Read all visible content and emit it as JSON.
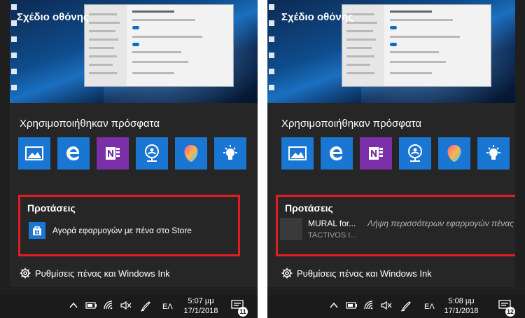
{
  "colors": {
    "panel_bg": "#1f1f1f",
    "tile_blue": "#1976d2",
    "tile_purple": "#7b2fa8",
    "highlight_red": "#e31b23",
    "taskbar_bg": "#1b1b1b"
  },
  "left": {
    "screen_sketch_label": "Σχέδιο οθόνης",
    "recent_title": "Χρησιμοποιήθηκαν πρόσφατα",
    "recent_apps": [
      "photos-icon",
      "edge-icon",
      "onenote-icon",
      "maps-icon",
      "paint3d-icon",
      "tips-icon"
    ],
    "suggestions_title": "Προτάσεις",
    "suggestion_text": "Αγορά εφαρμογών με πένα στο Store",
    "settings_label": "Ρυθμίσεις πένας και Windows Ink",
    "taskbar": {
      "lang": "ΕΛ",
      "time": "5:07 μμ",
      "date": "17/1/2018",
      "notifications": "11"
    }
  },
  "right": {
    "screen_sketch_label": "Σχέδιο οθόνης",
    "recent_title": "Χρησιμοποιήθηκαν πρόσφατα",
    "recent_apps": [
      "photos-icon",
      "edge-icon",
      "onenote-icon",
      "maps-icon",
      "paint3d-icon",
      "tips-icon"
    ],
    "suggestions_title": "Προτάσεις",
    "suggestion_app_name": "MURAL for...",
    "suggestion_app_publisher": "TACTIVOS I...",
    "suggestion_more": "Λήψη περισσότερων εφαρμογών πένας",
    "settings_label": "Ρυθμίσεις πένας και Windows Ink",
    "taskbar": {
      "lang": "ΕΛ",
      "time": "5:08 μμ",
      "date": "17/1/2018",
      "notifications": "12"
    }
  }
}
